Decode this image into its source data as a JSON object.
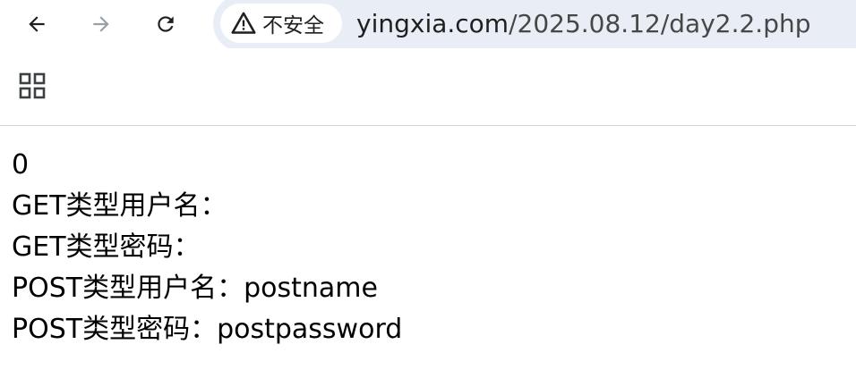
{
  "browser": {
    "security_label": "不安全",
    "url_host": "yingxia.com",
    "url_path": "/2025.08.12/day2.2.php",
    "omnibox_bg": "#e9eef6",
    "icons": {
      "back": "arrow-left-icon",
      "forward": "arrow-right-icon",
      "reload": "reload-icon",
      "security": "warning-triangle-icon",
      "apps": "apps-grid-icon"
    }
  },
  "page": {
    "lines": [
      "0",
      "GET类型用户名：",
      "GET类型密码：",
      "POST类型用户名：postname",
      "POST类型密码：postpassword"
    ]
  }
}
